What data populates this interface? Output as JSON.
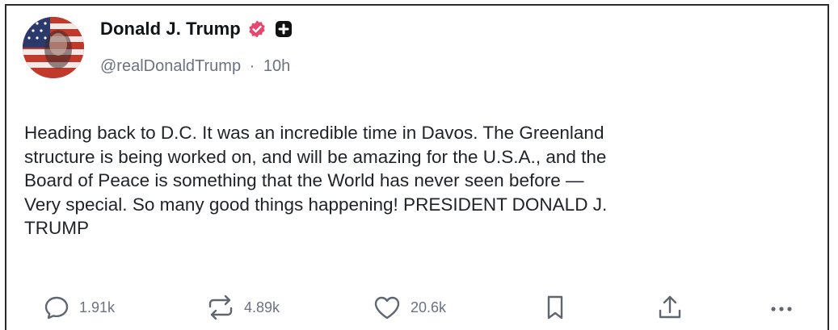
{
  "post": {
    "author": {
      "display_name": "Donald J. Trump",
      "handle": "@realDonaldTrump",
      "separator": "·",
      "timestamp": "10h",
      "verified_color": "#e8466c"
    },
    "text": "Heading back to D.C. It was an incredible time in Davos. The Greenland\nstructure is being worked on, and will be amazing for the U.S.A., and the\nBoard of Peace is something that the World has never seen before —\nVery special. So many good things happening! PRESIDENT DONALD J.\nTRUMP",
    "actions": {
      "replies": "1.91k",
      "reposts": "4.89k",
      "likes": "20.6k"
    }
  },
  "colors": {
    "text": "#1f2328",
    "muted": "#6b7280",
    "name": "#0f1419"
  },
  "icons": [
    "reply-icon",
    "repost-icon",
    "like-icon",
    "bookmark-icon",
    "share-icon",
    "more-icon",
    "verified-icon",
    "plus-badge-icon"
  ]
}
